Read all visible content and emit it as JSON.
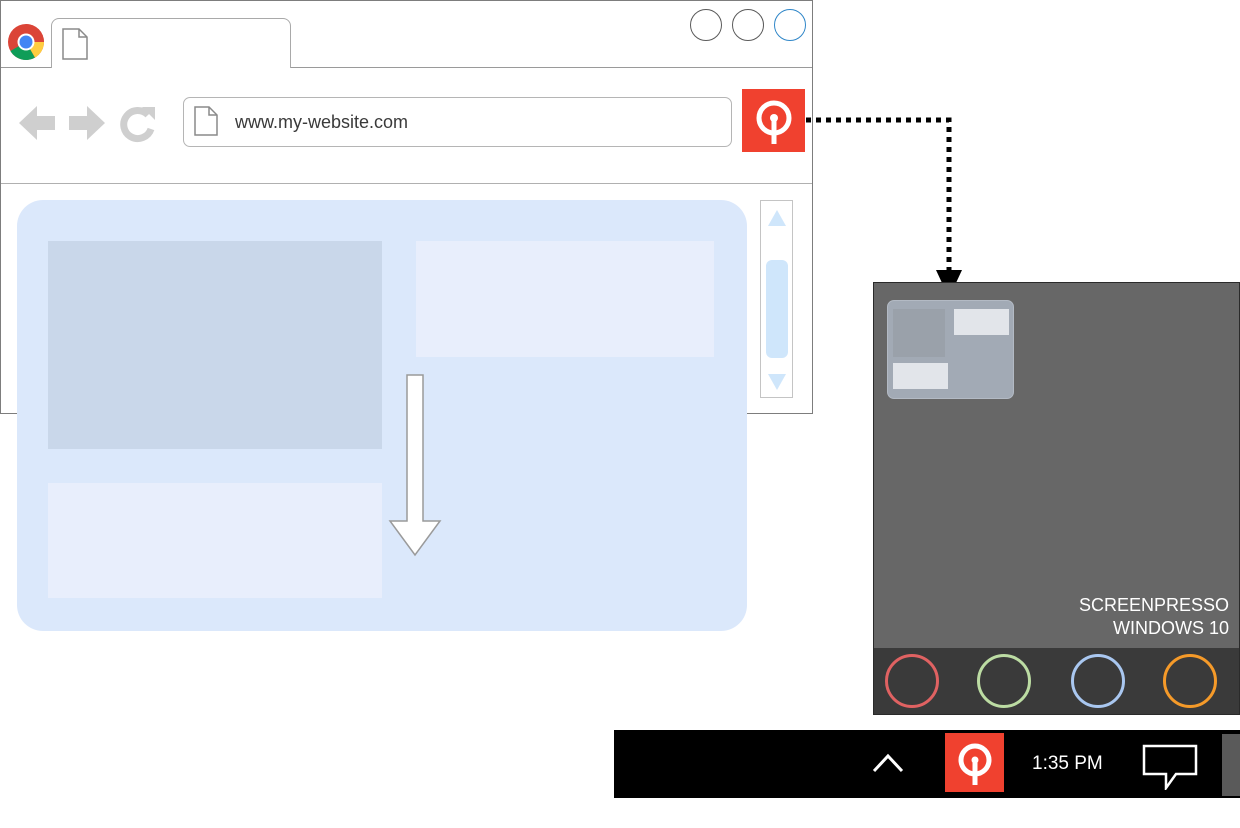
{
  "browser": {
    "url": "www.my-website.com",
    "window_controls": [
      "minimize",
      "maximize",
      "close"
    ],
    "nav_icons": [
      "back-arrow-icon",
      "forward-arrow-icon",
      "reload-icon"
    ],
    "extension_icon": "screenpresso-icon",
    "colors": {
      "accent_red": "#f0412f",
      "content_blue": "#dbe8fb"
    }
  },
  "screenpresso_panel": {
    "caption_line1": "SCREENPRESSO",
    "caption_line2": "WINDOWS 10",
    "footer_circles": [
      {
        "name": "red",
        "color": "#e06262"
      },
      {
        "name": "green",
        "color": "#bcdca3"
      },
      {
        "name": "blue",
        "color": "#a9c7f0"
      },
      {
        "name": "orange",
        "color": "#f59a29"
      }
    ]
  },
  "taskbar": {
    "clock": "1:35 PM",
    "icons": [
      "chevron-up-icon",
      "screenpresso-icon",
      "notification-icon"
    ]
  }
}
